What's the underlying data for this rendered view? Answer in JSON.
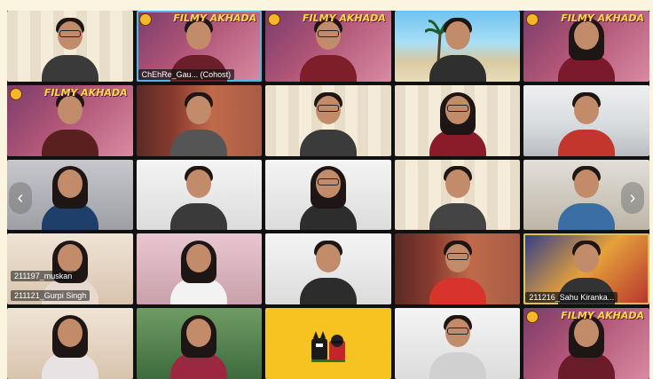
{
  "meeting": {
    "brand_logo_text": "FILMY AKHADA",
    "page_left_icon": "chevron-left-icon",
    "page_right_icon": "chevron-right-icon",
    "page_left_glyph": "‹",
    "page_right_glyph": "›",
    "active_border_color": "#4fb6e8",
    "page_background": "#fbf5df"
  },
  "participants": [
    {
      "label": "",
      "bg": "blinds"
    },
    {
      "label": "ChEhRe_Gau... (Cohost)",
      "bg": "brand",
      "brand": true,
      "active": true
    },
    {
      "label": "",
      "bg": "brand",
      "brand": true
    },
    {
      "label": "",
      "bg": "beach"
    },
    {
      "label": "",
      "bg": "brand",
      "brand": true
    },
    {
      "label": "",
      "bg": "brand",
      "brand": true
    },
    {
      "label": "",
      "bg": "curtain"
    },
    {
      "label": "",
      "bg": "blinds"
    },
    {
      "label": "",
      "bg": "blinds"
    },
    {
      "label": "",
      "bg": "room"
    },
    {
      "label": "",
      "bg": "grey"
    },
    {
      "label": "",
      "bg": "white"
    },
    {
      "label": "",
      "bg": "white"
    },
    {
      "label": "",
      "bg": "blinds"
    },
    {
      "label": "",
      "bg": "office"
    },
    {
      "label": "211197_muskan",
      "label2": "211121_Gurpi Singh",
      "bg": "warm"
    },
    {
      "label": "",
      "bg": "pink"
    },
    {
      "label": "",
      "bg": "white"
    },
    {
      "label": "",
      "bg": "curtain"
    },
    {
      "label": "211216_Sahu Kiranka...",
      "bg": "lego",
      "spotlight": true
    },
    {
      "label": "",
      "bg": "warm"
    },
    {
      "label": "",
      "bg": "green"
    },
    {
      "label": "",
      "bg": "yellow",
      "avatar": "batman-robin-icon"
    },
    {
      "label": "",
      "bg": "white"
    },
    {
      "label": "",
      "bg": "brand",
      "brand": true
    }
  ]
}
